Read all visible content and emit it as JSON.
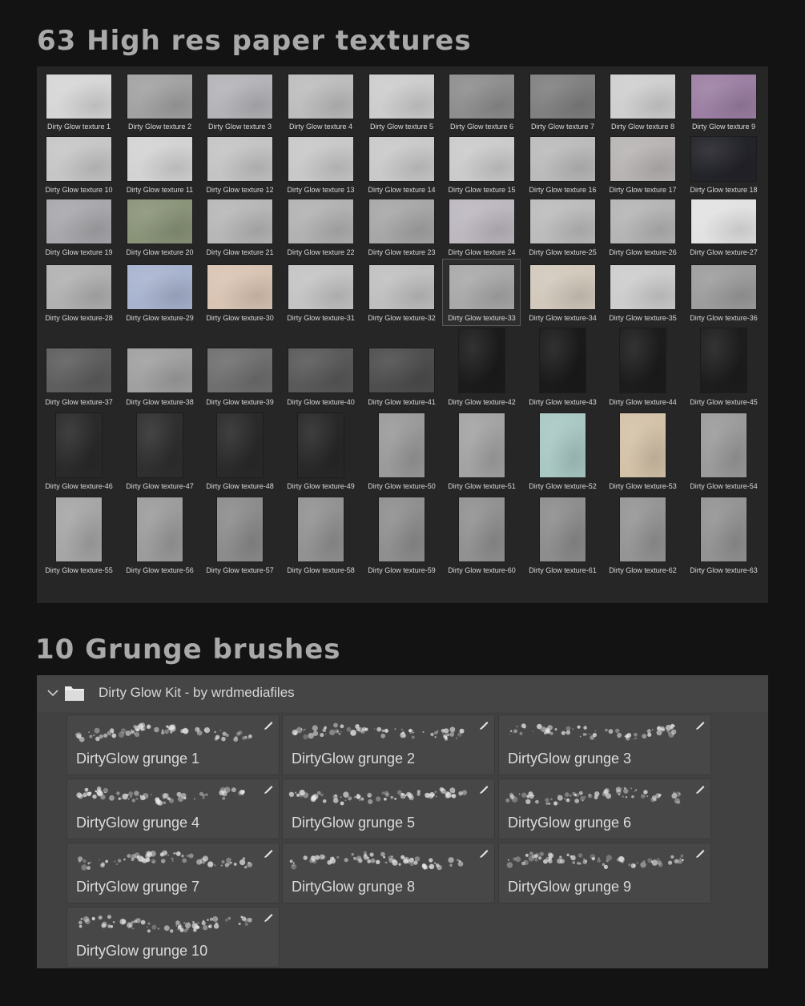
{
  "headings": {
    "textures": "63 High res paper textures",
    "brushes": "10 Grunge brushes"
  },
  "textures": [
    {
      "label": "Dirty Glow texture 1",
      "color": "#d6d6d6"
    },
    {
      "label": "Dirty Glow texture 2",
      "color": "#a2a2a2"
    },
    {
      "label": "Dirty Glow texture 3",
      "color": "#b4b4b8"
    },
    {
      "label": "Dirty Glow texture 4",
      "color": "#bdbdbd"
    },
    {
      "label": "Dirty Glow texture 5",
      "color": "#cdcdcd"
    },
    {
      "label": "Dirty Glow texture 6",
      "color": "#8e8e8e"
    },
    {
      "label": "Dirty Glow texture 7",
      "color": "#808080"
    },
    {
      "label": "Dirty Glow texture 8",
      "color": "#cfcfcf"
    },
    {
      "label": "Dirty Glow texture 9",
      "color": "#9c7fa3"
    },
    {
      "label": "Dirty Glow texture 10",
      "color": "#c6c6c6"
    },
    {
      "label": "Dirty Glow texture 11",
      "color": "#d3d3d3"
    },
    {
      "label": "Dirty Glow texture 12",
      "color": "#c4c4c4"
    },
    {
      "label": "Dirty Glow texture 13",
      "color": "#c8c8c8"
    },
    {
      "label": "Dirty Glow texture 14",
      "color": "#c9c9c9"
    },
    {
      "label": "Dirty Glow texture 15",
      "color": "#cbcbcb"
    },
    {
      "label": "Dirty Glow texture 16",
      "color": "#bbbbbb"
    },
    {
      "label": "Dirty Glow texture 17",
      "color": "#b8b4b4"
    },
    {
      "label": "Dirty Glow texture 18",
      "color": "#23232a"
    },
    {
      "label": "Dirty Glow texture 19",
      "color": "#a8a8ac"
    },
    {
      "label": "Dirty Glow texture 20",
      "color": "#8a9479"
    },
    {
      "label": "Dirty Glow texture 21",
      "color": "#b7b7b7"
    },
    {
      "label": "Dirty Glow texture 22",
      "color": "#b2b2b2"
    },
    {
      "label": "Dirty Glow texture 23",
      "color": "#a7a7a7"
    },
    {
      "label": "Dirty Glow texture 24",
      "color": "#bdb8c0"
    },
    {
      "label": "Dirty Glow texture-25",
      "color": "#bcbcbc"
    },
    {
      "label": "Dirty Glow texture-26",
      "color": "#b5b5b5"
    },
    {
      "label": "Dirty Glow texture-27",
      "color": "#e2e2e2"
    },
    {
      "label": "Dirty Glow texture-28",
      "color": "#b1b1b1"
    },
    {
      "label": "Dirty Glow texture-29",
      "color": "#a8b3cf"
    },
    {
      "label": "Dirty Glow texture-30",
      "color": "#d9c4b3"
    },
    {
      "label": "Dirty Glow texture-31",
      "color": "#c4c4c4"
    },
    {
      "label": "Dirty Glow texture-32",
      "color": "#c0c0c0"
    },
    {
      "label": "Dirty Glow texture-33",
      "color": "#a9a9a9"
    },
    {
      "label": "Dirty Glow texture-34",
      "color": "#d2c9bc"
    },
    {
      "label": "Dirty Glow texture-35",
      "color": "#cdcdcd"
    },
    {
      "label": "Dirty Glow texture-36",
      "color": "#9d9d9d"
    },
    {
      "label": "Dirty Glow texture-37",
      "color": "#5e5e5e"
    },
    {
      "label": "Dirty Glow texture-38",
      "color": "#a0a0a0"
    },
    {
      "label": "Dirty Glow texture-39",
      "color": "#6f6f6f"
    },
    {
      "label": "Dirty Glow texture-40",
      "color": "#595959"
    },
    {
      "label": "Dirty Glow texture-41",
      "color": "#4e4e4e"
    },
    {
      "label": "Dirty Glow texture-42",
      "color": "#1b1b1b"
    },
    {
      "label": "Dirty Glow texture-43",
      "color": "#1a1a1a"
    },
    {
      "label": "Dirty Glow texture-44",
      "color": "#1c1c1c"
    },
    {
      "label": "Dirty Glow texture-45",
      "color": "#1d1d1d"
    },
    {
      "label": "Dirty Glow texture-46",
      "color": "#2a2a2a"
    },
    {
      "label": "Dirty Glow texture-47",
      "color": "#2f2f2f"
    },
    {
      "label": "Dirty Glow texture-48",
      "color": "#2a2a2a"
    },
    {
      "label": "Dirty Glow texture-49",
      "color": "#282828"
    },
    {
      "label": "Dirty Glow texture-50",
      "color": "#9a9a9a"
    },
    {
      "label": "Dirty Glow texture-51",
      "color": "#a3a3a3"
    },
    {
      "label": "Dirty Glow texture-52",
      "color": "#a9c8c4"
    },
    {
      "label": "Dirty Glow texture-53",
      "color": "#d4c2a8"
    },
    {
      "label": "Dirty Glow texture-54",
      "color": "#9b9b9b"
    },
    {
      "label": "Dirty Glow texture-55",
      "color": "#a6a6a6"
    },
    {
      "label": "Dirty Glow texture-56",
      "color": "#9c9c9c"
    },
    {
      "label": "Dirty Glow texture-57",
      "color": "#8c8c8c"
    },
    {
      "label": "Dirty Glow texture-58",
      "color": "#929292"
    },
    {
      "label": "Dirty Glow texture-59",
      "color": "#8f8f8f"
    },
    {
      "label": "Dirty Glow texture-60",
      "color": "#919191"
    },
    {
      "label": "Dirty Glow texture-61",
      "color": "#8d8d8d"
    },
    {
      "label": "Dirty Glow texture-62",
      "color": "#959595"
    },
    {
      "label": "Dirty Glow texture-63",
      "color": "#939393"
    }
  ],
  "selected_texture": "Dirty Glow texture-33",
  "brush_group": {
    "label": "Dirty Glow Kit - by wrdmediafiles",
    "expanded": true,
    "icon": "folder-icon"
  },
  "brushes": [
    {
      "name": "DirtyGlow grunge 1"
    },
    {
      "name": "DirtyGlow grunge 2"
    },
    {
      "name": "DirtyGlow grunge 3"
    },
    {
      "name": "DirtyGlow grunge 4"
    },
    {
      "name": "DirtyGlow grunge 5"
    },
    {
      "name": "DirtyGlow grunge 6"
    },
    {
      "name": "DirtyGlow grunge 7"
    },
    {
      "name": "DirtyGlow grunge 8"
    },
    {
      "name": "DirtyGlow grunge 9"
    },
    {
      "name": "DirtyGlow grunge 10"
    }
  ]
}
